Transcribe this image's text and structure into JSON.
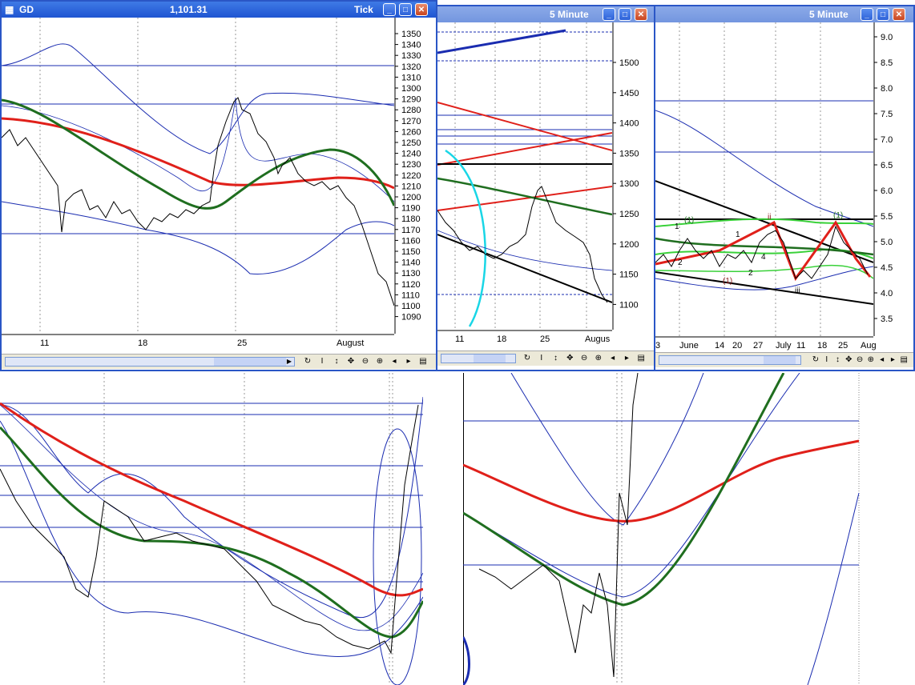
{
  "windows": {
    "gd": {
      "symbol": "GD",
      "price": "1,101.31",
      "interval": "Tick",
      "y_ticks": [
        "1350",
        "1340",
        "1330",
        "1320",
        "1310",
        "1300",
        "1290",
        "1280",
        "1270",
        "1260",
        "1250",
        "1240",
        "1230",
        "1220",
        "1210",
        "1200",
        "1190",
        "1180",
        "1170",
        "1160",
        "1150",
        "1140",
        "1130",
        "1120",
        "1110",
        "1100",
        "1090"
      ],
      "x_ticks": [
        "11",
        "18",
        "25",
        "August"
      ]
    },
    "mid": {
      "interval": "5 Minute",
      "y_ticks": [
        "1500",
        "1450",
        "1400",
        "1350",
        "1300",
        "1250",
        "1200",
        "1150",
        "1100"
      ],
      "x_ticks": [
        "11",
        "18",
        "25",
        "Augus"
      ]
    },
    "right": {
      "interval": "5 Minute",
      "y_ticks": [
        "9.0",
        "8.5",
        "8.0",
        "7.5",
        "7.0",
        "6.5",
        "6.0",
        "5.5",
        "5.0",
        "4.5",
        "4.0",
        "3.5"
      ],
      "x_ticks": [
        "3",
        "June",
        "14",
        "20",
        "27",
        "July",
        "11",
        "18",
        "25",
        "Aug"
      ],
      "wave_labels": [
        "1",
        "(1)",
        "2",
        "(1)",
        "ii",
        "1",
        "2",
        "4",
        "iii",
        "(1)"
      ]
    }
  },
  "toolbar_icons": [
    "refresh-icon",
    "cursor-icon",
    "vertical-move-icon",
    "pan-icon",
    "zoom-out-icon",
    "zoom-in-icon",
    "scroll-left-icon",
    "scroll-right-icon",
    "menu-icon"
  ],
  "toolbar_glyphs": [
    "↻",
    "I",
    "↕",
    "✥",
    "⊖",
    "⊕",
    "◂",
    "▸",
    "▤"
  ],
  "colors": {
    "title_active": "#1f55d1",
    "price_line": "#000000",
    "band": "#1a2cb0",
    "ma_red": "#e0201a",
    "ma_green": "#1f6e1f",
    "bright_green": "#3ad13a",
    "cyan": "#19d6e6"
  }
}
